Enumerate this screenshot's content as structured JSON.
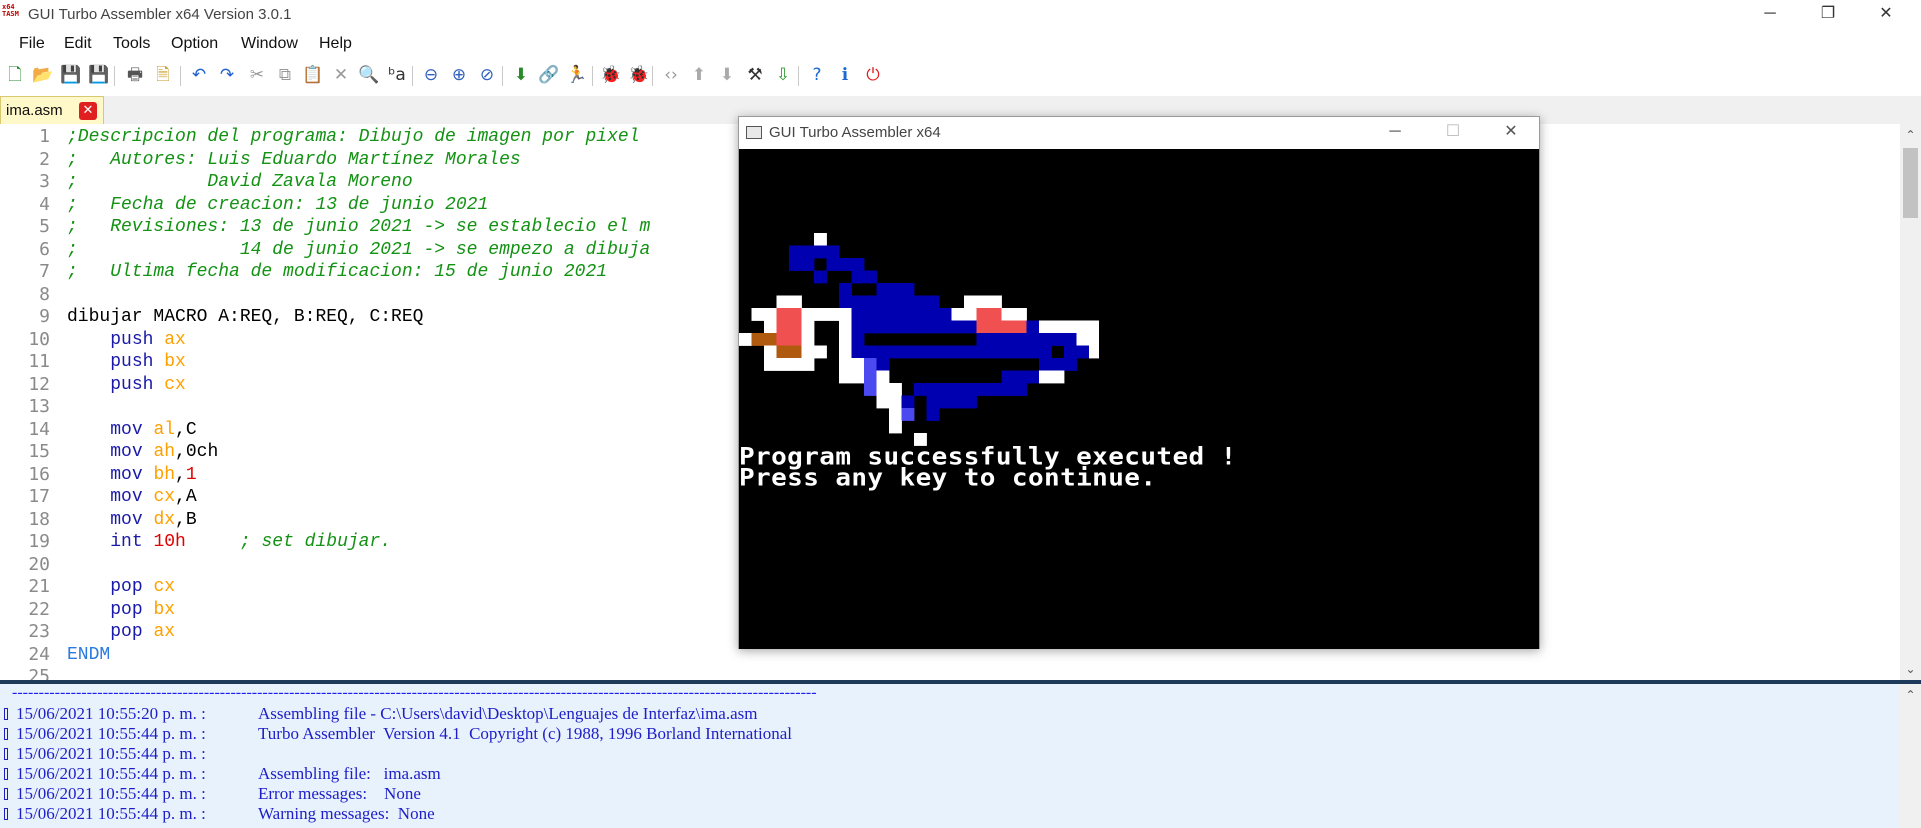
{
  "window": {
    "title": "GUI Turbo Assembler x64 Version 3.0.1",
    "app_icon_text": "x64 TASM",
    "minimize_glyph": "─",
    "restore_glyph": "❐",
    "close_glyph": "✕"
  },
  "menu": [
    "File",
    "Edit",
    "Tools",
    "Option",
    "Window",
    "Help"
  ],
  "toolbar": {
    "buttons": [
      {
        "name": "new-file-icon",
        "glyph": "🗋",
        "color": "#2a8a2a"
      },
      {
        "name": "open-file-icon",
        "glyph": "📂",
        "color": "#c79a20"
      },
      {
        "name": "save-icon",
        "glyph": "💾",
        "color": "#777777"
      },
      {
        "name": "save-all-icon",
        "glyph": "💾",
        "color": "#777777"
      },
      {
        "name": "print-icon",
        "glyph": "🖶",
        "color": "#555555"
      },
      {
        "name": "print-preview-icon",
        "glyph": "🗎",
        "color": "#c79a20"
      },
      {
        "name": "undo-icon",
        "glyph": "↶",
        "color": "#2060d0"
      },
      {
        "name": "redo-icon",
        "glyph": "↷",
        "color": "#2060d0"
      },
      {
        "name": "cut-icon",
        "glyph": "✂",
        "color": "#999999"
      },
      {
        "name": "copy-icon",
        "glyph": "⧉",
        "color": "#999999"
      },
      {
        "name": "paste-icon",
        "glyph": "📋",
        "color": "#999999"
      },
      {
        "name": "delete-icon",
        "glyph": "✕",
        "color": "#999999"
      },
      {
        "name": "find-icon",
        "glyph": "🔍",
        "color": "#555555"
      },
      {
        "name": "replace-icon",
        "glyph": "ᵇa",
        "color": "#333333"
      },
      {
        "name": "zoom-out-icon",
        "glyph": "⊖",
        "color": "#3060c0"
      },
      {
        "name": "zoom-in-icon",
        "glyph": "⊕",
        "color": "#3060c0"
      },
      {
        "name": "zoom-reset-icon",
        "glyph": "⊘",
        "color": "#3060c0"
      },
      {
        "name": "assemble-icon",
        "glyph": "⬇",
        "color": "#2a8a2a"
      },
      {
        "name": "link-icon",
        "glyph": "🔗",
        "color": "#d02020"
      },
      {
        "name": "run-icon",
        "glyph": "🏃",
        "color": "#222222"
      },
      {
        "name": "debug-icon",
        "glyph": "🐞",
        "color": "#c04020"
      },
      {
        "name": "debug-step-icon",
        "glyph": "🐞",
        "color": "#2a8a2a"
      },
      {
        "name": "code-icon",
        "glyph": "‹›",
        "color": "#999999"
      },
      {
        "name": "move-up-icon",
        "glyph": "⬆",
        "color": "#aaaaaa"
      },
      {
        "name": "move-down-icon",
        "glyph": "⬇",
        "color": "#aaaaaa"
      },
      {
        "name": "tools-icon",
        "glyph": "⚒",
        "color": "#333333"
      },
      {
        "name": "download-icon",
        "glyph": "⇩",
        "color": "#2a9a2a"
      },
      {
        "name": "help-icon",
        "glyph": "?",
        "color": "#1a6ad0"
      },
      {
        "name": "info-icon",
        "glyph": "ℹ",
        "color": "#1a6ad0"
      },
      {
        "name": "power-icon",
        "glyph": "⏻",
        "color": "#e02020"
      }
    ]
  },
  "tab": {
    "label": "ima.asm",
    "close_glyph": "✕"
  },
  "editor": {
    "lines": [
      {
        "n": "1",
        "html": "<span class='cm'>;Descripcion del programa: Dibujo de imagen por pixel</span>"
      },
      {
        "n": "2",
        "html": "<span class='cm'>;   Autores: Luis Eduardo Martínez Morales</span>"
      },
      {
        "n": "3",
        "html": "<span class='cm'>;            David Zavala Moreno</span>"
      },
      {
        "n": "4",
        "html": "<span class='cm'>;   Fecha de creacion: 13 de junio 2021</span>"
      },
      {
        "n": "5",
        "html": "<span class='cm'>;   Revisiones: 13 de junio 2021 -> se establecio el m</span>"
      },
      {
        "n": "6",
        "html": "<span class='cm'>;               14 de junio 2021 -> se empezo a dibuja</span>"
      },
      {
        "n": "7",
        "html": "<span class='cm'>;   Ultima fecha de modificacion: 15 de junio 2021</span>"
      },
      {
        "n": "8",
        "html": ""
      },
      {
        "n": "9",
        "html": "dibujar MACRO A:REQ, B:REQ, C:REQ"
      },
      {
        "n": "10",
        "html": "    <span class='kw'>push</span> <span class='reg'>ax</span>"
      },
      {
        "n": "11",
        "html": "    <span class='kw'>push</span> <span class='reg'>bx</span>"
      },
      {
        "n": "12",
        "html": "    <span class='kw'>push</span> <span class='reg'>cx</span>"
      },
      {
        "n": "13",
        "html": ""
      },
      {
        "n": "14",
        "html": "    <span class='kw'>mov</span> <span class='reg'>al</span>,C"
      },
      {
        "n": "15",
        "html": "    <span class='kw'>mov</span> <span class='reg'>ah</span>,0ch"
      },
      {
        "n": "16",
        "html": "    <span class='kw'>mov</span> <span class='reg'>bh</span>,<span class='num'>1</span>"
      },
      {
        "n": "17",
        "html": "    <span class='kw'>mov</span> <span class='reg'>cx</span>,A"
      },
      {
        "n": "18",
        "html": "    <span class='kw'>mov</span> <span class='reg'>dx</span>,B"
      },
      {
        "n": "19",
        "html": "    <span class='kw'>int</span> <span class='num'>10h</span>     <span class='cm'>; set dibujar.</span>"
      },
      {
        "n": "20",
        "html": ""
      },
      {
        "n": "21",
        "html": "    <span class='kw'>pop</span> <span class='reg'>cx</span>"
      },
      {
        "n": "22",
        "html": "    <span class='kw'>pop</span> <span class='reg'>bx</span>"
      },
      {
        "n": "23",
        "html": "    <span class='kw'>pop</span> <span class='reg'>ax</span>"
      },
      {
        "n": "24",
        "html": "<span class='endm'>ENDM</span>"
      },
      {
        "n": "25",
        "html": ""
      }
    ],
    "scroll_up_glyph": "⌃",
    "scroll_down_glyph": "⌄"
  },
  "output": {
    "separator": "-------------------------------------------------------------------------------------------------------------------------------------------------------",
    "lines": [
      {
        "time": "15/06/2021 10:55:20 p. m. :",
        "msg": "Assembling file - C:\\Users\\david\\Desktop\\Lenguajes de Interfaz\\ima.asm"
      },
      {
        "time": "15/06/2021 10:55:44 p. m. :",
        "msg": "Turbo Assembler  Version 4.1  Copyright (c) 1988, 1996 Borland International"
      },
      {
        "time": "15/06/2021 10:55:44 p. m. :",
        "msg": ""
      },
      {
        "time": "15/06/2021 10:55:44 p. m. :",
        "msg": "Assembling file:   ima.asm"
      },
      {
        "time": "15/06/2021 10:55:44 p. m. :",
        "msg": "Error messages:    None"
      },
      {
        "time": "15/06/2021 10:55:44 p. m. :",
        "msg": "Warning messages:  None"
      }
    ]
  },
  "dos_window": {
    "title": "GUI Turbo Assembler x64",
    "minimize_glyph": "─",
    "maximize_glyph": "☐",
    "close_glyph": "✕",
    "line1": "Program successfully executed !",
    "line2": "Press any key to continue.",
    "palette": {
      "W": "#ffffff",
      "B": "#0000b0",
      "L": "#4a4af0",
      "R": "#f05050",
      "O": "#b05a10"
    },
    "sprite": [
      "......W.........................",
      "....BBBB........................",
      "....BB.BBB......................",
      "......B..BB.....................",
      "........B..BBB..................",
      "...WW...BBBBBBBB..WWW...........",
      ".WWRRWWWWBBBBBBBBWWRRWW.........",
      "..WRRW..WBBBBBBBBBBRRRRBWWWWW...",
      "WOORRW..WB.........BBBBBBBBWWWW.",
      "..WOOWW.WBBBBBBBBBBBBBBBB.BBWW..",
      "..WWWW..WWLB............BBB.....",
      "........WWLW.........BBBWW......",
      "..........LWW.BBBBBBBBB.........",
      "...........WWB.BBBB.............",
      "............WL.B................",
      "............W...................",
      "..............W................."
    ]
  }
}
